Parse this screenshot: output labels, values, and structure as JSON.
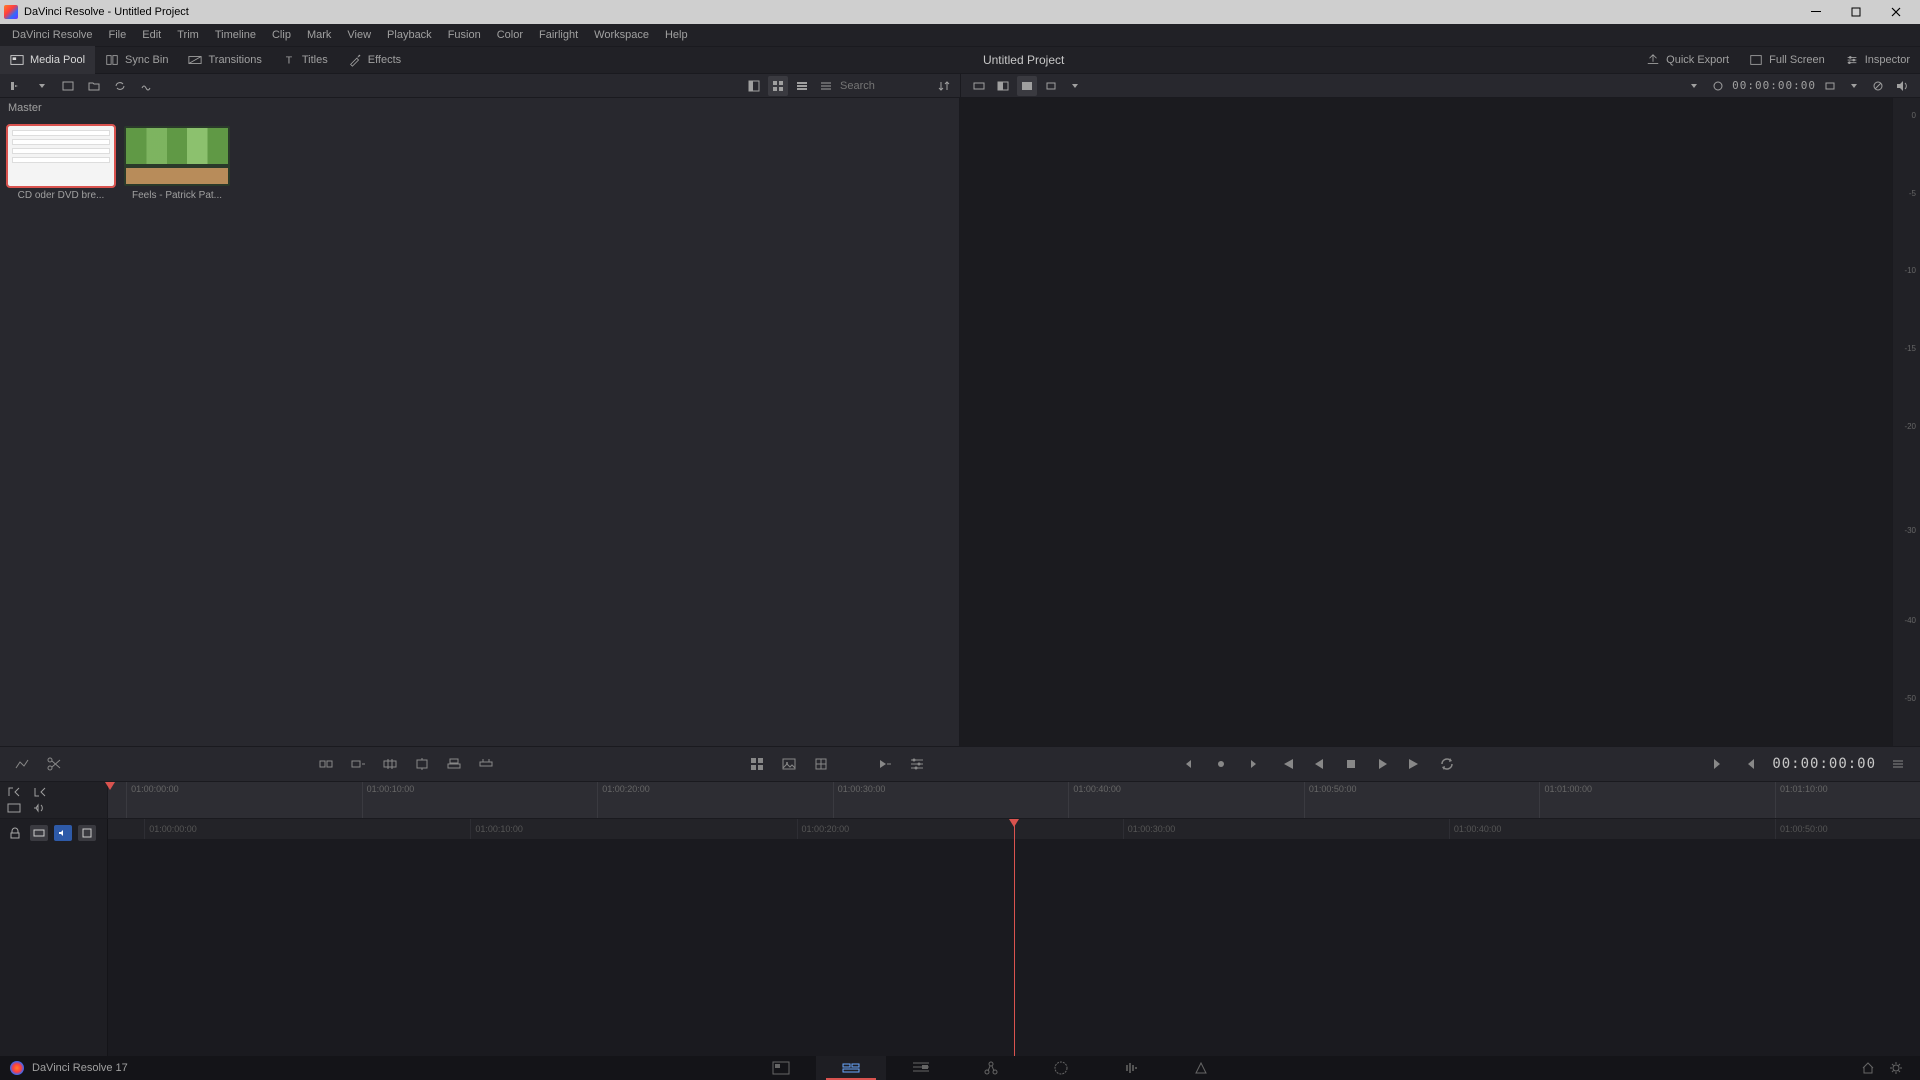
{
  "window": {
    "title": "DaVinci Resolve - Untitled Project"
  },
  "menu": {
    "items": [
      "DaVinci Resolve",
      "File",
      "Edit",
      "Trim",
      "Timeline",
      "Clip",
      "Mark",
      "View",
      "Playback",
      "Fusion",
      "Color",
      "Fairlight",
      "Workspace",
      "Help"
    ]
  },
  "toolrow": {
    "media_pool": "Media Pool",
    "sync_bin": "Sync Bin",
    "transitions": "Transitions",
    "titles": "Titles",
    "effects": "Effects",
    "project_title": "Untitled Project",
    "quick_export": "Quick Export",
    "full_screen": "Full Screen",
    "inspector": "Inspector"
  },
  "subrow": {
    "search_placeholder": "Search",
    "viewer_timecode": "00:00:00:00"
  },
  "mediapool": {
    "breadcrumb": "Master",
    "clips": [
      {
        "label": "CD oder DVD bre..."
      },
      {
        "label": "Feels - Patrick Pat..."
      }
    ]
  },
  "meter": {
    "ticks": [
      "0",
      "-5",
      "-10",
      "-15",
      "-20",
      "-30",
      "-40",
      "-50"
    ]
  },
  "transport": {
    "timecode": "00:00:00:00"
  },
  "ruler_top": {
    "marks": [
      "01:00:00:00",
      "01:00:10:00",
      "01:00:20:00",
      "01:00:30:00",
      "01:00:40:00",
      "01:00:50:00",
      "01:01:00:00",
      "01:01:10:00"
    ]
  },
  "ruler_bottom": {
    "marks": [
      "01:00:00:00",
      "01:00:10:00",
      "01:00:20:00",
      "01:00:30:00",
      "01:00:40:00",
      "01:00:50:00"
    ]
  },
  "footer": {
    "version": "DaVinci Resolve 17"
  }
}
